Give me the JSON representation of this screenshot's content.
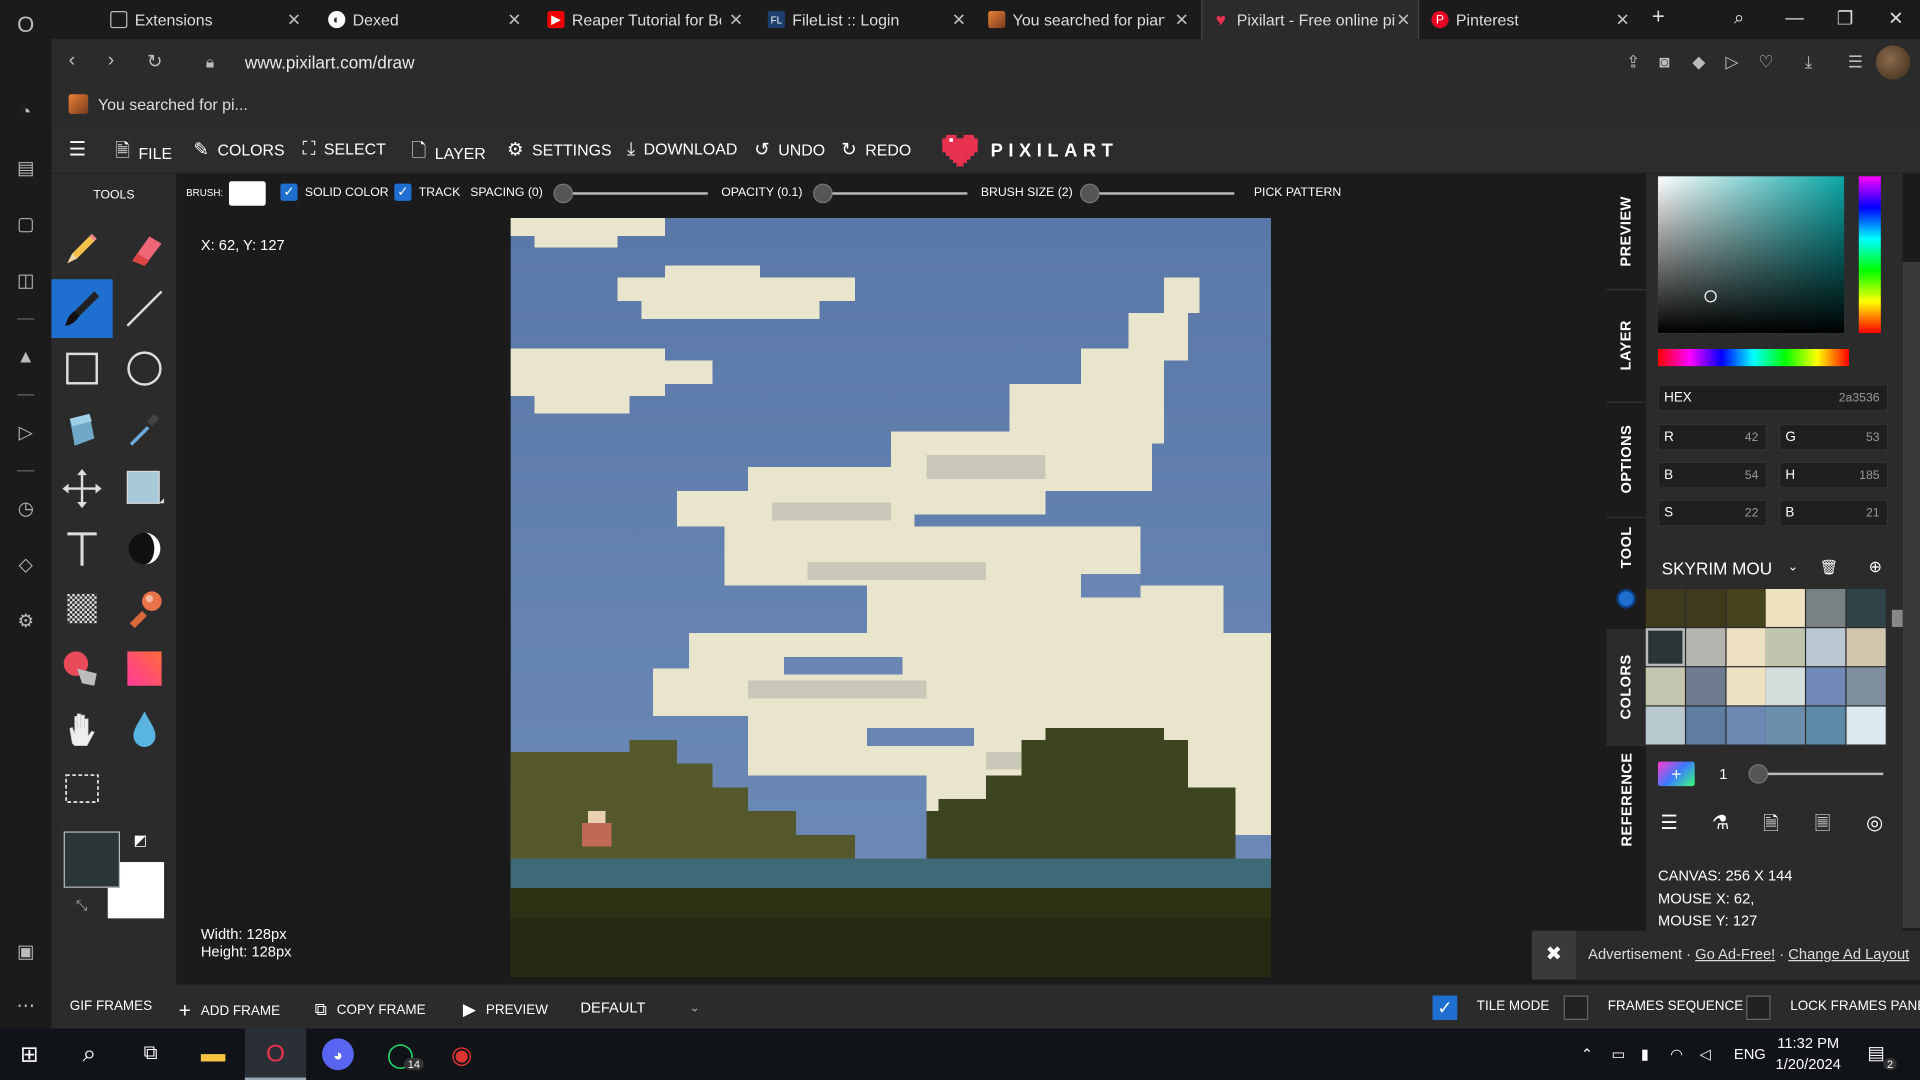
{
  "browser": {
    "tabs": [
      {
        "label": "Extensions",
        "icon": "puzzle-icon"
      },
      {
        "label": "Dexed",
        "icon": "dexed-icon"
      },
      {
        "label": "Reaper Tutorial for Beg",
        "icon": "youtube-icon"
      },
      {
        "label": "FileList :: Login",
        "icon": "filelist-icon"
      },
      {
        "label": "You searched for piano",
        "icon": "site-icon"
      },
      {
        "label": "Pixilart - Free online pix",
        "icon": "pixilart-heart-icon",
        "active": true
      },
      {
        "label": "Pinterest",
        "icon": "pinterest-icon"
      }
    ],
    "url": "www.pixilart.com/draw",
    "bookmark_label": "You searched for pi..."
  },
  "menu": {
    "file": "FILE",
    "colors": "COLORS",
    "select": "SELECT",
    "layer": "LAYER",
    "settings": "SETTINGS",
    "download": "DOWNLOAD",
    "undo": "UNDO",
    "redo": "REDO",
    "logo": "PIXILART"
  },
  "tools": {
    "title": "TOOLS",
    "items": [
      "pencil",
      "eraser",
      "brush",
      "line",
      "rectangle",
      "circle",
      "bucket",
      "eyedropper",
      "move",
      "shape-fill",
      "text",
      "shade",
      "dither",
      "stamp",
      "color-replace",
      "gradient",
      "hand",
      "blur",
      "select"
    ],
    "active": "brush",
    "primary_color": "#2a3536",
    "secondary_color": "#ffffff"
  },
  "options": {
    "brush": "BRUSH:",
    "solid_color": "SOLID COLOR",
    "track": "TRACK",
    "spacing": "SPACING (0)",
    "opacity": "OPACITY (0.1)",
    "brush_size": "BRUSH SIZE (2)",
    "pick_pattern": "PICK PATTERN"
  },
  "workspace": {
    "coords": "X: 62, Y: 127",
    "width": "Width: 128px",
    "height": "Height: 128px"
  },
  "side_tabs": [
    "PREVIEW",
    "LAYER",
    "OPTIONS",
    "TOOL",
    "COLORS",
    "REFERENCE"
  ],
  "color_picker": {
    "hex_label": "HEX",
    "hex": "2a3536",
    "r_label": "R",
    "r": "42",
    "g_label": "G",
    "g": "53",
    "b_label": "B",
    "b": "54",
    "h_label": "H",
    "h": "185",
    "s_label": "S",
    "s": "22",
    "br_label": "B",
    "br": "21"
  },
  "palette": {
    "name": "SKYRIM MOU",
    "count": "1",
    "colors": [
      "#3e3a1c",
      "#3f3a1c",
      "#46421d",
      "#ede1c0",
      "#7a8184",
      "#2f4348",
      "#2a3536",
      "#b5b5b0",
      "#ece0c1",
      "#c0c6ae",
      "#b9c7d0",
      "#cfc6ad",
      "#c4c6b0",
      "#6f7b8e",
      "#ede2c3",
      "#d4dedd",
      "#7089b6",
      "#7f8fa0",
      "#b8c8cf",
      "#5f7d9e",
      "#6d88b0",
      "#6c8fae",
      "#5d8aa6",
      "#dbeaf0"
    ],
    "selected_index": 6
  },
  "canvas_info": {
    "canvas": "CANVAS: 256 X 144",
    "mouse_x": "MOUSE X: 62,",
    "mouse_y": "MOUSE Y: 127"
  },
  "ad": {
    "label": "Advertisement · ",
    "go_ad_free": "Go Ad-Free!",
    "sep": " · ",
    "change_layout": "Change Ad Layout"
  },
  "bottom": {
    "gif_frames": "GIF FRAMES",
    "add_frame": "ADD FRAME",
    "copy_frame": "COPY FRAME",
    "preview": "PREVIEW",
    "default": "DEFAULT",
    "tile_mode": "TILE MODE",
    "frames_sequence": "FRAMES SEQUENCE",
    "lock_frames_panel": "LOCK FRAMES PANEL"
  },
  "taskbar": {
    "whatsapp_badge": "14",
    "lang": "ENG",
    "time": "11:32 PM",
    "date": "1/20/2024",
    "notif_count": "2"
  },
  "colors": {
    "accent": "#1f6fd0",
    "pixilart_red": "#e8314f",
    "panel": "#2b2b2b",
    "background": "#1b1b1b"
  }
}
